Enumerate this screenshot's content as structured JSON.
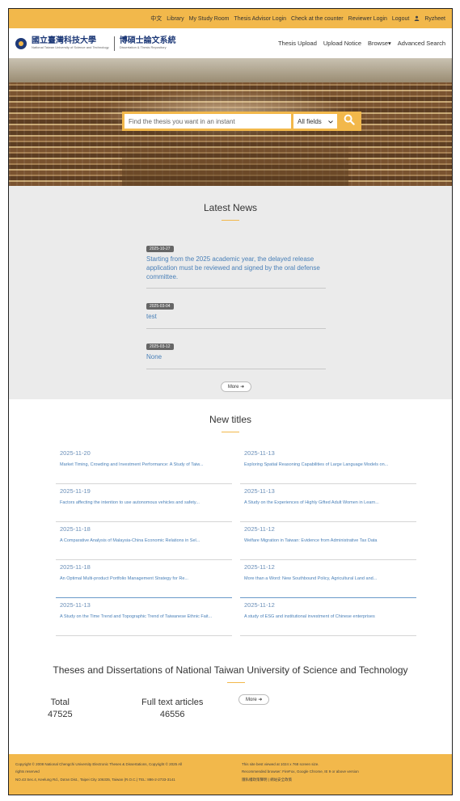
{
  "topbar": {
    "items": [
      "中文",
      "Library",
      "My Study Room",
      "Thesis Advisor Login",
      "Check at the counter",
      "Reviewer Login",
      "Logout",
      "Ryzheet"
    ]
  },
  "header": {
    "logo_text": "國立臺灣科技大學",
    "logo_subtext": "National Taiwan University of Science and Technology",
    "repo_title": "博碩士論文系統",
    "repo_subtitle": "Dissertation & Thesis Repository",
    "nav": [
      "Thesis Upload",
      "Upload Notice",
      "Browse▾",
      "Advanced Search"
    ]
  },
  "search": {
    "placeholder": "Find the thesis you want in an instant",
    "field_select": "All fields",
    "button_icon": "search-icon"
  },
  "news": {
    "title": "Latest News",
    "items": [
      {
        "date": "2025-10-27",
        "text": "Starting from the 2025 academic year, the delayed release application must be reviewed and signed by the oral defense committee."
      },
      {
        "date": "2025-03-04",
        "text": "test"
      },
      {
        "date": "2025-03-12",
        "text": "None"
      }
    ],
    "more": "More"
  },
  "new_titles": {
    "title": "New titles",
    "items": [
      {
        "date": "2025-11-20",
        "title": "Market Timing, Crowding and Investment Performance: A Study of Taiw..."
      },
      {
        "date": "2025-11-13",
        "title": "Exploring Spatial Reasoning Capabilities of Large Language Models on..."
      },
      {
        "date": "2025-11-19",
        "title": "Factors affecting the intention to use autonomous vehicles and safety..."
      },
      {
        "date": "2025-11-13",
        "title": "A Study on the Experiences of Highly Gifted Adult Women in Learn..."
      },
      {
        "date": "2025-11-18",
        "title": "A Comparative Analysis of Malaysia-China Economic Relations in Sel..."
      },
      {
        "date": "2025-11-12",
        "title": "Welfare Migration in Taiwan: Evidence from Administrative Tax Data"
      },
      {
        "date": "2025-11-18",
        "title": "An Optimal Multi-product Portfolio Management Strategy for Re..."
      },
      {
        "date": "2025-11-12",
        "title": "More than a Word: New Southbound Policy, Agricultural Land and..."
      },
      {
        "date": "2025-11-13",
        "title": "A Study on the Time Trend and Topographic Trend of Taiwanese Ethnic Fait..."
      },
      {
        "date": "2025-11-12",
        "title": "A study of ESG and institutional investment of Chinese enterprises"
      }
    ]
  },
  "stats": {
    "title": "Theses and Dissertations of National Taiwan University of Science and Technology",
    "total_label": "Total",
    "total_value": "47525",
    "fulltext_label": "Full text articles",
    "fulltext_value": "46556",
    "more": "More"
  },
  "footer": {
    "left_line1": "Copyright © 2008 National Chengchi University Electronic Theses & Dissertations, Copyright © 2025 All",
    "left_line2": "rights reserved",
    "left_line3": "NO.43 Sec.4, Keelung Rd., Da'an Dist., Taipei City 106335, Taiwan (R.O.C.) TEL: 886-2-2733-3141",
    "right_line1": "This site best viewed at 1024 x 768 screen size.",
    "right_line2": "Recommended browser: FireFox, Google Chrome, IE 9 or above version",
    "right_line3": "隱私權政策聲明 | 網站安全政策"
  },
  "colors": {
    "accent": "#f2b84b",
    "link": "#4a80b8",
    "news_bg": "#ebebeb"
  }
}
